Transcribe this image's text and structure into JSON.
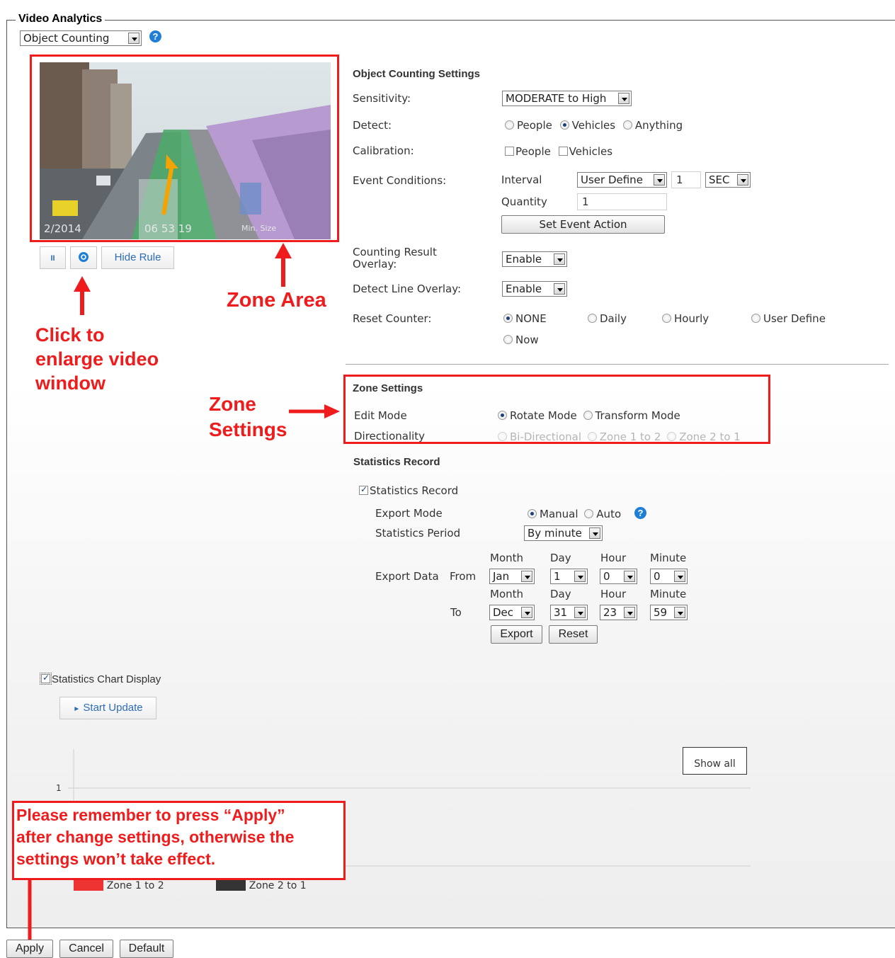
{
  "panel": {
    "title": "Video Analytics",
    "mode_select": "Object Counting"
  },
  "video": {
    "overlay_date": "2/2014",
    "overlay_time": "06 53 19",
    "overlay_size": "Min. Size",
    "controls": {
      "pause_icon": "pause-icon",
      "zoom_icon": "zoom-icon",
      "hide_rule": "Hide Rule"
    }
  },
  "settings": {
    "title": "Object Counting Settings",
    "sensitivity": {
      "label": "Sensitivity:",
      "value": "MODERATE to High"
    },
    "detect": {
      "label": "Detect:",
      "options": [
        "People",
        "Vehicles",
        "Anything"
      ],
      "selected": "Vehicles"
    },
    "calibration": {
      "label": "Calibration:",
      "options": [
        "People",
        "Vehicles"
      ]
    },
    "event_conditions": {
      "label": "Event Conditions:",
      "interval_label": "Interval",
      "interval_select": "User Define",
      "interval_value": "1",
      "interval_unit": "SEC",
      "quantity_label": "Quantity",
      "quantity_value": "1",
      "set_action": "Set Event Action"
    },
    "counting_overlay": {
      "label": "Counting Result Overlay:",
      "value": "Enable"
    },
    "detect_line_overlay": {
      "label": "Detect Line Overlay:",
      "value": "Enable"
    },
    "reset_counter": {
      "label": "Reset Counter:",
      "options": [
        "NONE",
        "Daily",
        "Hourly",
        "User Define",
        "Now"
      ],
      "selected": "NONE"
    }
  },
  "zone": {
    "title": "Zone Settings",
    "edit_mode": {
      "label": "Edit Mode",
      "options": [
        "Rotate Mode",
        "Transform Mode"
      ],
      "selected": "Rotate Mode"
    },
    "directionality": {
      "label": "Directionality",
      "options": [
        "Bi-Directional",
        "Zone 1 to 2",
        "Zone 2 to 1"
      ]
    }
  },
  "statistics": {
    "title": "Statistics Record",
    "checkbox": "Statistics Record",
    "export_mode": {
      "label": "Export Mode",
      "options": [
        "Manual",
        "Auto"
      ],
      "selected": "Manual"
    },
    "period": {
      "label": "Statistics Period",
      "value": "By minute"
    },
    "export_data_label": "Export Data",
    "from_label": "From",
    "to_label": "To",
    "col_headers": [
      "Month",
      "Day",
      "Hour",
      "Minute"
    ],
    "from": [
      "Jan",
      "1",
      "0",
      "0"
    ],
    "to": [
      "Dec",
      "31",
      "23",
      "59"
    ],
    "export_btn": "Export",
    "reset_btn": "Reset"
  },
  "chart_display": {
    "checkbox": "Statistics Chart Display",
    "start_update": "Start Update",
    "show_all": "Show all"
  },
  "chart_data": {
    "type": "line",
    "categories": [],
    "series": [
      {
        "name": "Zone 1 to 2",
        "color": "#ee3333",
        "values": []
      },
      {
        "name": "Zone 2 to 1",
        "color": "#333333",
        "values": []
      }
    ],
    "ytick": "1"
  },
  "footer": {
    "apply": "Apply",
    "cancel": "Cancel",
    "default": "Default"
  },
  "annotations": {
    "zone_area": "Zone Area",
    "enlarge": [
      "Click to",
      "enlarge video",
      "window"
    ],
    "zone_settings": [
      "Zone",
      "Settings"
    ],
    "reminder": [
      "Please remember to press “Apply”",
      "after change settings, otherwise the",
      "settings won’t take effect."
    ]
  },
  "colors": {
    "annotation_red": "#ee1c1c",
    "link_blue": "#2d6cb7"
  }
}
